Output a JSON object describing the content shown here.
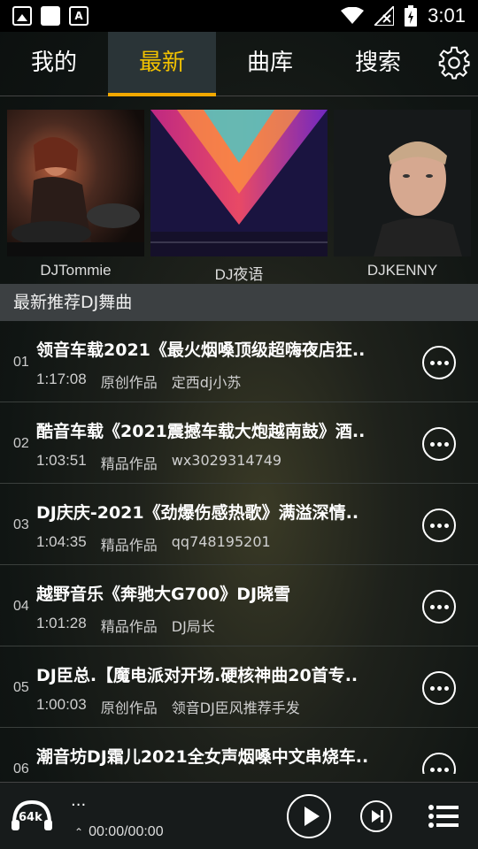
{
  "status_bar": {
    "time": "3:01",
    "icons": [
      "image-icon",
      "notification-square-icon",
      "font-app-icon",
      "wifi-icon",
      "signal-icon",
      "battery-charging-icon"
    ]
  },
  "tabs": [
    {
      "label": "我的",
      "active": false
    },
    {
      "label": "最新",
      "active": true
    },
    {
      "label": "曲库",
      "active": false
    },
    {
      "label": "搜索",
      "active": false
    }
  ],
  "banner": [
    {
      "label": "DJTommie"
    },
    {
      "label": "DJ夜语"
    },
    {
      "label": "DJKENNY"
    }
  ],
  "section_title": "最新推荐DJ舞曲",
  "songs": [
    {
      "num": "01",
      "title": "领音车载2021《最火烟嗓顶级超嗨夜店狂..",
      "duration": "1:17:08",
      "category": "原创作品",
      "author": "定西dj小苏"
    },
    {
      "num": "02",
      "title": "酷音车载《2021震撼车载大炮越南鼓》酒..",
      "duration": "1:03:51",
      "category": "精品作品",
      "author": "wx3029314749"
    },
    {
      "num": "03",
      "title": "DJ庆庆-2021《劲爆伤感热歌》满溢深情..",
      "duration": "1:04:35",
      "category": "精品作品",
      "author": "qq748195201"
    },
    {
      "num": "04",
      "title": "越野音乐《奔驰大G700》DJ晓雪",
      "duration": "1:01:28",
      "category": "精品作品",
      "author": "DJ局长"
    },
    {
      "num": "05",
      "title": "DJ臣总.【魔电派对开场.硬核神曲20首专..",
      "duration": "1:00:03",
      "category": "原创作品",
      "author": "领音DJ臣风推荐手发"
    },
    {
      "num": "06",
      "title": "潮音坊DJ霜儿2021全女声烟嗓中文串烧车..",
      "duration": "",
      "category": "",
      "author": ""
    }
  ],
  "player": {
    "quality": "64k",
    "title": "...",
    "time": "00:00/00:00"
  },
  "colors": {
    "accent": "#f2c200",
    "tab_underline": "#f2a800"
  }
}
